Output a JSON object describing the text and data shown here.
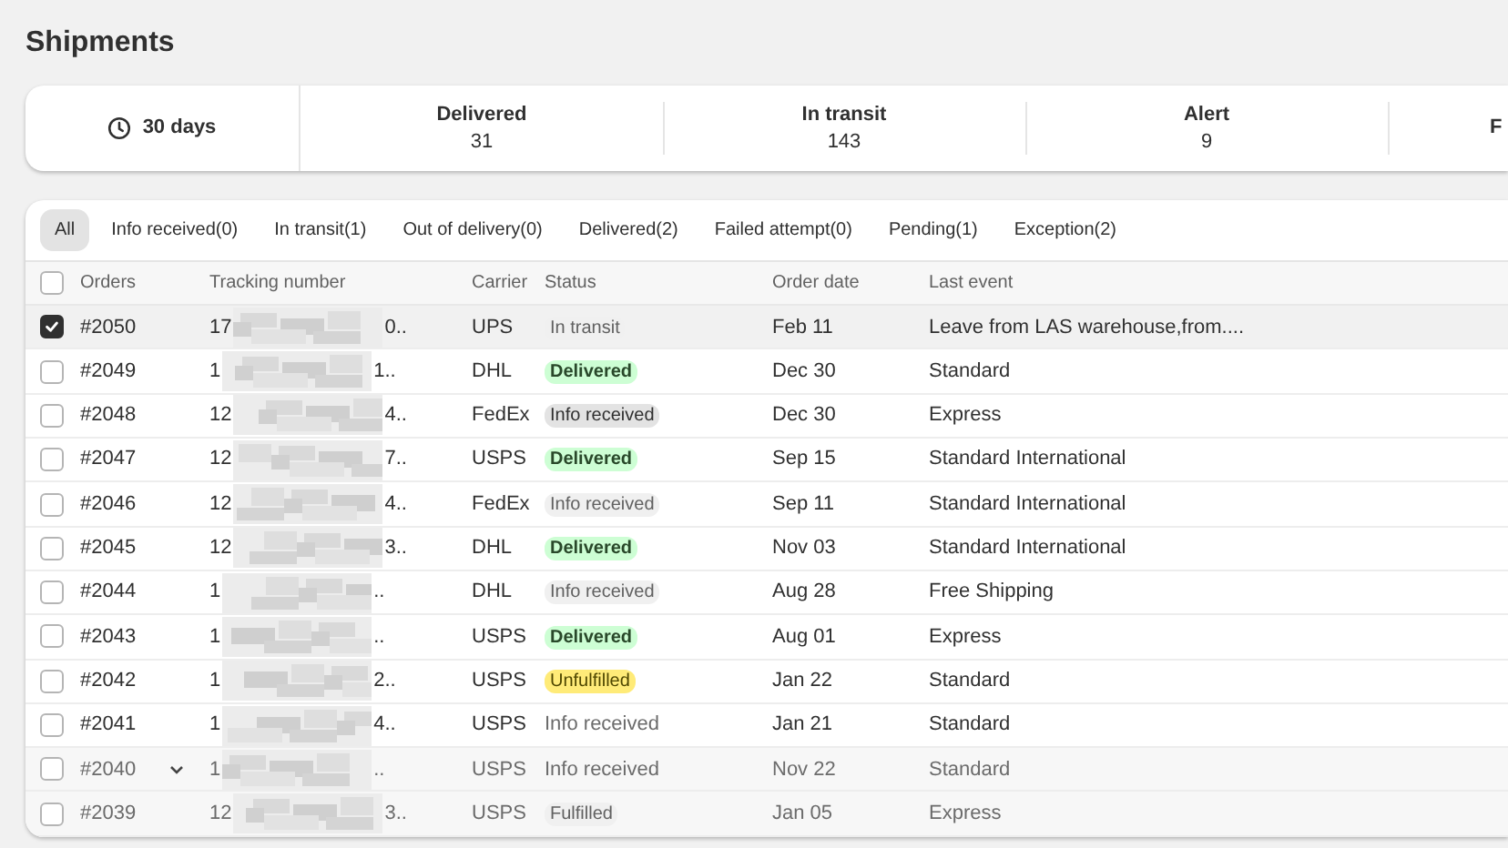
{
  "title": "Shipments",
  "summary": {
    "period": "30 days",
    "stats": [
      {
        "label": "Delivered",
        "value": "31"
      },
      {
        "label": "In transit",
        "value": "143"
      },
      {
        "label": "Alert",
        "value": "9"
      },
      {
        "label": "F"
      }
    ]
  },
  "tabs": [
    {
      "label": "All",
      "selected": true
    },
    {
      "label": "Info received(0)",
      "selected": false
    },
    {
      "label": "In transit(1)",
      "selected": false
    },
    {
      "label": "Out of delivery(0)",
      "selected": false
    },
    {
      "label": "Delivered(2)",
      "selected": false
    },
    {
      "label": "Failed attempt(0)",
      "selected": false
    },
    {
      "label": "Pending(1)",
      "selected": false
    },
    {
      "label": "Exception(2)",
      "selected": false
    }
  ],
  "table": {
    "select_all_checked": false,
    "columns": [
      "Orders",
      "Tracking number",
      "Carrier",
      "Status",
      "Order date",
      "Last event"
    ],
    "rows": [
      {
        "order": "#2050",
        "tracking_start": "17",
        "tracking_end": "0..",
        "carrier": "UPS",
        "status": {
          "text": "In transit",
          "kind": "faint"
        },
        "date": "Feb 11",
        "event": "Leave from LAS warehouse,from....",
        "checked": true,
        "shaded": false,
        "expandable": false
      },
      {
        "order": "#2049",
        "tracking_start": "1",
        "tracking_end": "1..",
        "carrier": "DHL",
        "status": {
          "text": "Delivered",
          "kind": "success"
        },
        "date": "Dec 30",
        "event": "Standard",
        "checked": false,
        "shaded": false,
        "expandable": false
      },
      {
        "order": "#2048",
        "tracking_start": "12",
        "tracking_end": "4..",
        "carrier": "FedEx",
        "status": {
          "text": "Info received",
          "kind": "neutral"
        },
        "date": "Dec 30",
        "event": "Express",
        "checked": false,
        "shaded": false,
        "expandable": false
      },
      {
        "order": "#2047",
        "tracking_start": "12",
        "tracking_end": "7..",
        "carrier": "USPS",
        "status": {
          "text": "Delivered",
          "kind": "success"
        },
        "date": "Sep 15",
        "event": "Standard International",
        "checked": false,
        "shaded": false,
        "expandable": false
      },
      {
        "order": "#2046",
        "tracking_start": "12",
        "tracking_end": "4..",
        "carrier": "FedEx",
        "status": {
          "text": "Info received",
          "kind": "faint"
        },
        "date": "Sep 11",
        "event": "Standard International",
        "checked": false,
        "shaded": false,
        "expandable": false
      },
      {
        "order": "#2045",
        "tracking_start": "12",
        "tracking_end": "3..",
        "carrier": "DHL",
        "status": {
          "text": "Delivered",
          "kind": "success"
        },
        "date": "Nov 03",
        "event": "Standard International",
        "checked": false,
        "shaded": false,
        "expandable": false
      },
      {
        "order": "#2044",
        "tracking_start": "1",
        "tracking_end": "..",
        "carrier": "DHL",
        "status": {
          "text": "Info received",
          "kind": "faint"
        },
        "date": "Aug 28",
        "event": "Free Shipping",
        "checked": false,
        "shaded": false,
        "expandable": false
      },
      {
        "order": "#2043",
        "tracking_start": "1",
        "tracking_end": "..",
        "carrier": "USPS",
        "status": {
          "text": "Delivered",
          "kind": "success"
        },
        "date": "Aug 01",
        "event": "Express",
        "checked": false,
        "shaded": false,
        "expandable": false
      },
      {
        "order": "#2042",
        "tracking_start": "1",
        "tracking_end": "2..",
        "carrier": "USPS",
        "status": {
          "text": "Unfulfilled",
          "kind": "warning"
        },
        "date": "Jan 22",
        "event": "Standard",
        "checked": false,
        "shaded": false,
        "expandable": false
      },
      {
        "order": "#2041",
        "tracking_start": "1",
        "tracking_end": "4..",
        "carrier": "USPS",
        "status": {
          "text": "Info received",
          "kind": "plain"
        },
        "date": "Jan 21",
        "event": "Standard",
        "checked": false,
        "shaded": false,
        "expandable": false
      },
      {
        "order": "#2040",
        "tracking_start": "1",
        "tracking_end": "..",
        "carrier": "USPS",
        "status": {
          "text": "Info received",
          "kind": "plain"
        },
        "date": "Nov 22",
        "event": "Standard",
        "checked": false,
        "shaded": true,
        "expandable": true
      },
      {
        "order": "#2039",
        "tracking_start": "12",
        "tracking_end": "3..",
        "carrier": "USPS",
        "status": {
          "text": "Fulfilled",
          "kind": "faint"
        },
        "date": "Jan 05",
        "event": "Express",
        "checked": false,
        "shaded": true,
        "expandable": false
      }
    ]
  }
}
